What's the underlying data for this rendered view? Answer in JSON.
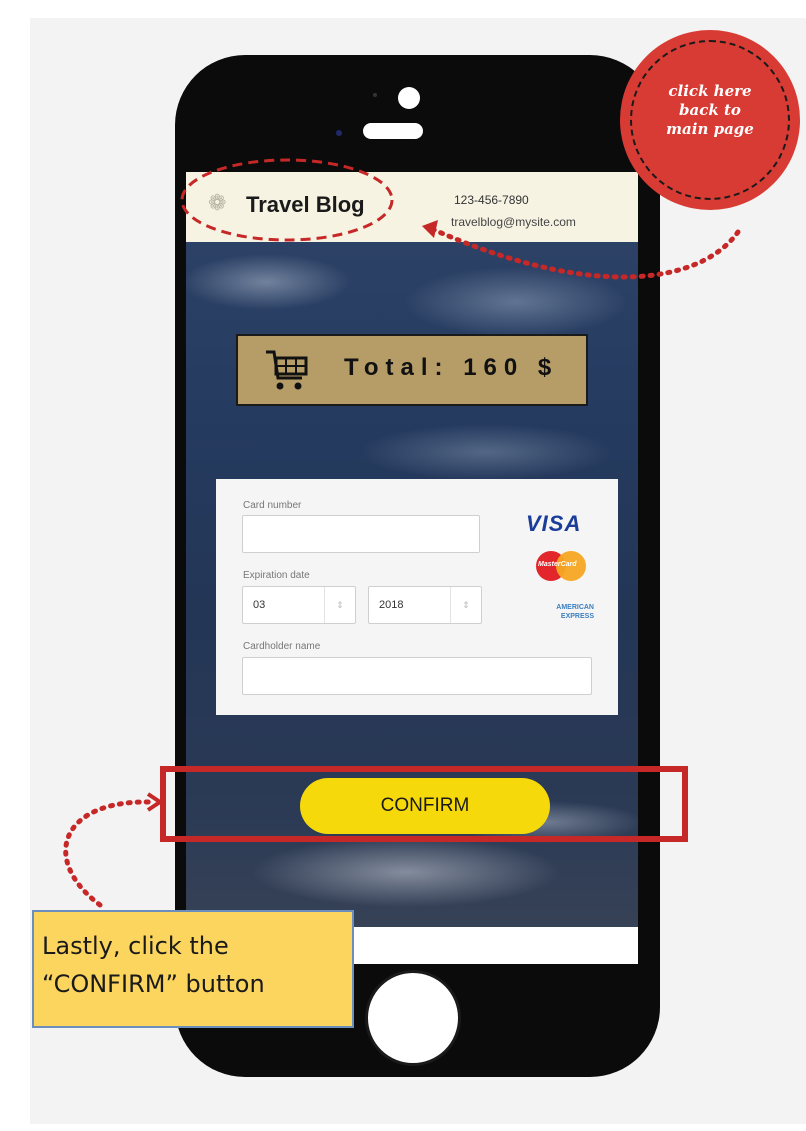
{
  "site": {
    "title": "Travel Blog",
    "phone": "123-456-7890",
    "email": "travelblog@mysite.com",
    "logo_icon": "flower-logo-icon"
  },
  "cart": {
    "icon": "shopping-cart-icon",
    "total_label": "Total: 160 $"
  },
  "card_form": {
    "card_number_label": "Card number",
    "card_number_value": "",
    "expiration_label": "Expiration date",
    "exp_month": "03",
    "exp_year": "2018",
    "cardholder_label": "Cardholder name",
    "cardholder_value": "",
    "brands": {
      "visa": "VISA",
      "mastercard": "MasterCard",
      "amex_line1": "AMERICAN",
      "amex_line2": "EXPRESS"
    }
  },
  "confirm_label": "CONFIRM",
  "annotations": {
    "badge_line1": "click here",
    "badge_line2": "back to",
    "badge_line3": "main page",
    "note_line1": "Lastly, click the",
    "note_line2": "“CONFIRM” button"
  },
  "colors": {
    "accent_yellow": "#f6d90b",
    "annotation_red": "#c62828",
    "note_yellow": "#fcd55f",
    "total_box": "#b69d68"
  }
}
